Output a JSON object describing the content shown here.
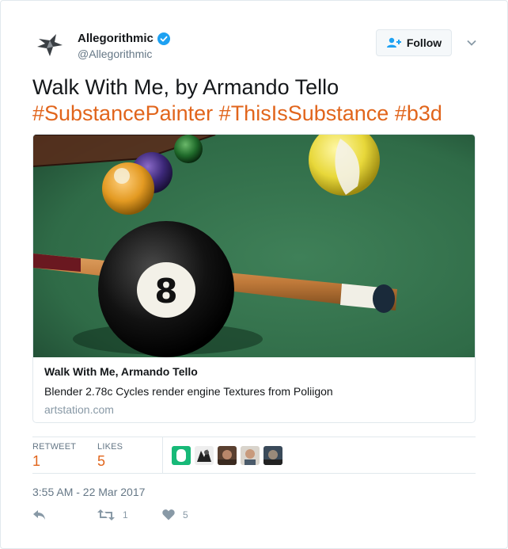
{
  "account": {
    "name": "Allegorithmic",
    "handle": "@Allegorithmic",
    "verified": true,
    "avatar_icon": "bird-logo-icon"
  },
  "follow_button": {
    "label": "Follow",
    "icon": "add-user-icon"
  },
  "tweet": {
    "line1": "Walk With Me, by Armando Tello",
    "hashtags": [
      "#SubstancePainter",
      "#ThisIsSubstance",
      "#b3d"
    ]
  },
  "link_card": {
    "title": "Walk With Me, Armando Tello",
    "description": "Blender 2.78c Cycles render engine Textures from Poliigon",
    "domain": "artstation.com"
  },
  "stats": {
    "retweets_label": "RETWEET",
    "retweets": "1",
    "likes_label": "LIKES",
    "likes": "5"
  },
  "timestamp": "3:55 AM - 22 Mar 2017",
  "actions": {
    "reply_icon": "reply-icon",
    "retweet_icon": "retweet-icon",
    "retweet_count": "1",
    "like_icon": "heart-icon",
    "like_count": "5"
  },
  "colors": {
    "hashtag": "#e1651c",
    "verified": "#1da1f2",
    "table_felt": "#2f6b47"
  }
}
